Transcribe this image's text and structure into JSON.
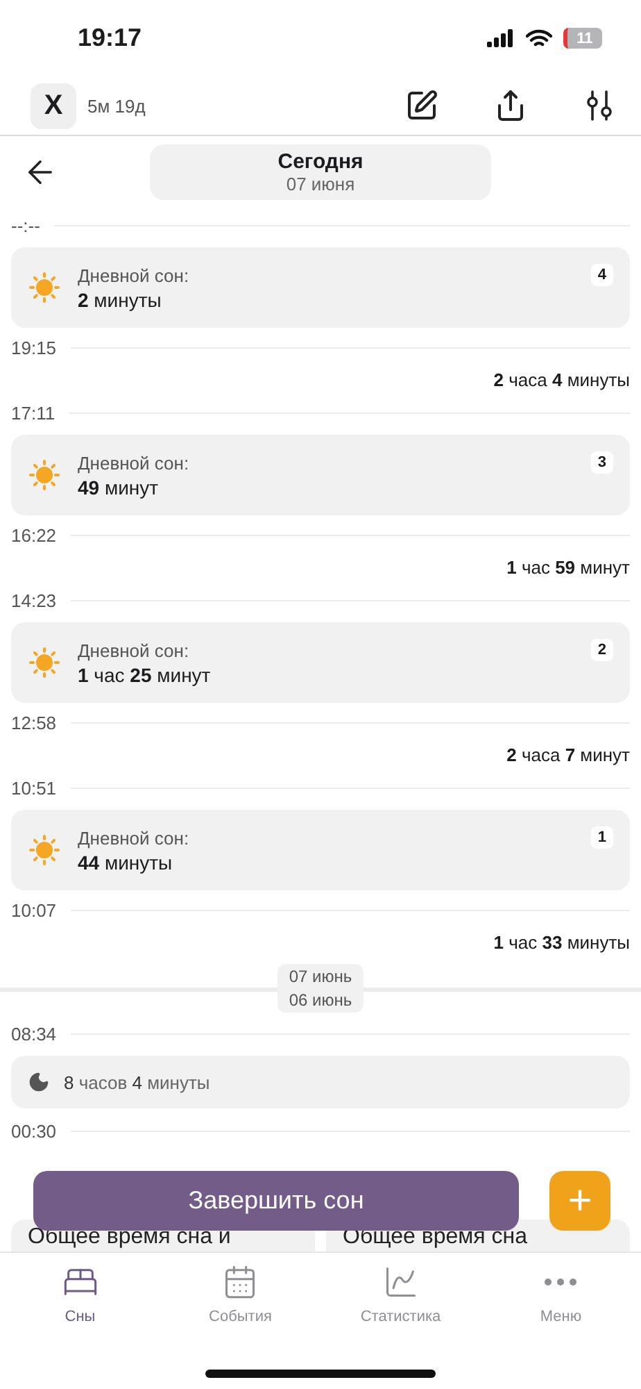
{
  "status_bar": {
    "time": "19:17",
    "battery": "11"
  },
  "header": {
    "avatar": "X",
    "age": "5м 19д"
  },
  "date_nav": {
    "title": "Сегодня",
    "date": "07 июня"
  },
  "timeline": [
    {
      "kind": "time",
      "label": "--:--"
    },
    {
      "kind": "nap",
      "title": "Дневной сон:",
      "duration": "**2** минуты",
      "badge": "4"
    },
    {
      "kind": "time",
      "label": "19:15"
    },
    {
      "kind": "awake",
      "duration": "**2** часа **4** минуты"
    },
    {
      "kind": "time",
      "label": "17:11"
    },
    {
      "kind": "nap",
      "title": "Дневной сон:",
      "duration": "**49** минут",
      "badge": "3"
    },
    {
      "kind": "time",
      "label": "16:22"
    },
    {
      "kind": "awake",
      "duration": "**1** час **59** минут"
    },
    {
      "kind": "time",
      "label": "14:23"
    },
    {
      "kind": "nap",
      "title": "Дневной сон:",
      "duration": "**1** час **25** минут",
      "badge": "2"
    },
    {
      "kind": "time",
      "label": "12:58"
    },
    {
      "kind": "awake",
      "duration": "**2** часа **7** минут"
    },
    {
      "kind": "time",
      "label": "10:51"
    },
    {
      "kind": "nap",
      "title": "Дневной сон:",
      "duration": "**44** минуты",
      "badge": "1"
    },
    {
      "kind": "time",
      "label": "10:07"
    },
    {
      "kind": "awake",
      "duration": "**1** час **33** минуты"
    },
    {
      "kind": "day_break",
      "dates": [
        "07 июнь",
        "06 июнь"
      ]
    },
    {
      "kind": "time",
      "label": "08:34"
    },
    {
      "kind": "night",
      "duration": "**8** часов **4** минуты"
    },
    {
      "kind": "time",
      "label": "00:30"
    }
  ],
  "stats": {
    "cards": [
      "Общее время сна и",
      "Общее время сна"
    ]
  },
  "main_button": "Завершить сон",
  "add_button": "+",
  "tabs": [
    {
      "label": "Сны",
      "selected": true
    },
    {
      "label": "События",
      "selected": false
    },
    {
      "label": "Статистика",
      "selected": false
    },
    {
      "label": "Меню",
      "selected": false
    }
  ]
}
